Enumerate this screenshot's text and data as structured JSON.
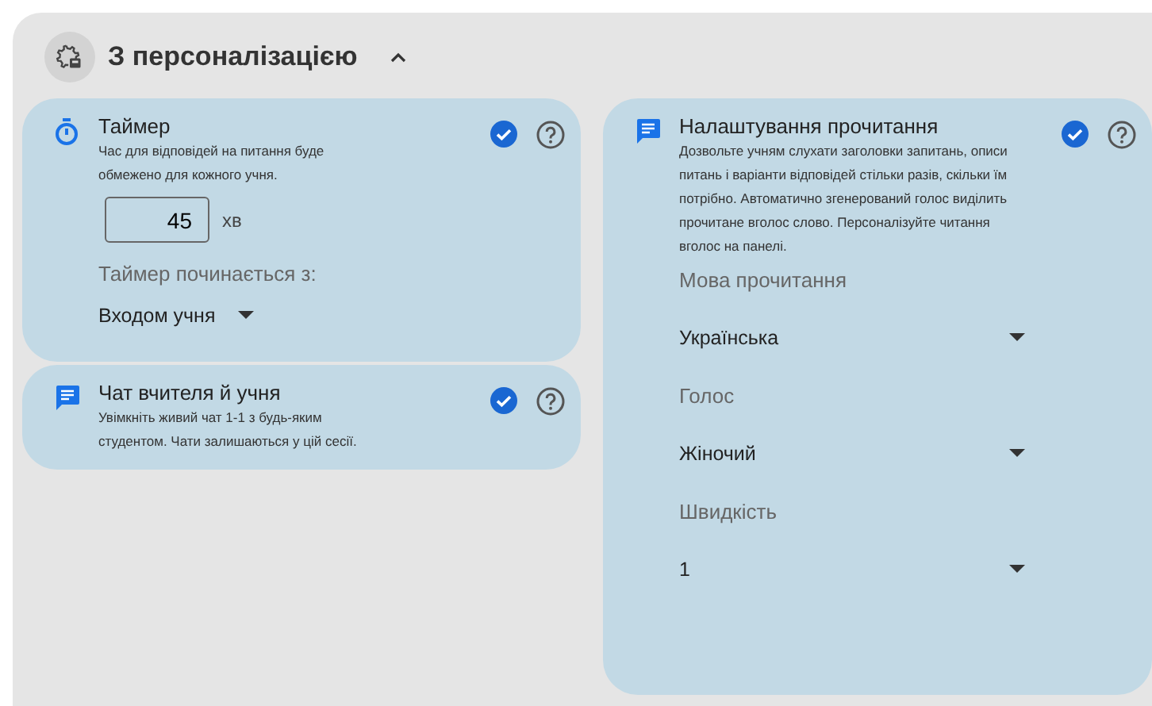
{
  "section": {
    "title": "З персоналізацією",
    "expanded": true
  },
  "columns": [
    [
      {
        "kind": "timer",
        "title": "Таймер",
        "description": "Час для відповідей на питання буде обмежено для кожного учня.",
        "checked": true,
        "duration": {
          "value": "45",
          "unit": "хв"
        },
        "fields": [
          {
            "label": "Таймер починається з:",
            "value": "Входом учня"
          }
        ]
      },
      {
        "kind": "chat",
        "title": "Чат вчителя й учня",
        "description": "Увімкніть живий чат 1-1 з будь-яким студентом. Чати залишаються у цій сесії.",
        "checked": true
      }
    ],
    [
      {
        "kind": "reading",
        "title": "Налаштування прочитання",
        "description": "Дозвольте учням слухати заголовки запитань, описи питань і варіанти відповідей стільки разів, скільки їм потрібно. Автоматично згенерований голос виділить прочитане вголос слово. Персоналізуйте читання вголос на панелі.",
        "checked": true,
        "fields": [
          {
            "label": "Мова прочитання",
            "value": "Українська"
          },
          {
            "label": "Голос",
            "value": "Жіночий"
          },
          {
            "label": "Швидкість",
            "value": "1"
          }
        ]
      }
    ]
  ]
}
